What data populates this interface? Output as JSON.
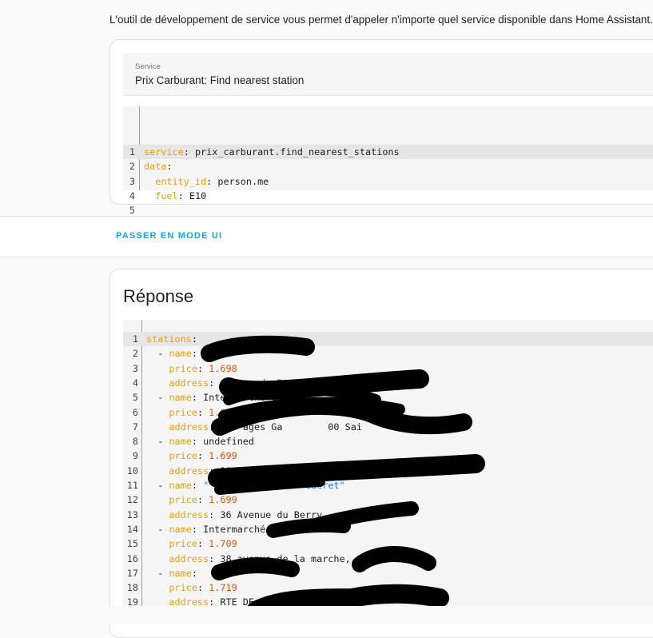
{
  "intro_text": "L'outil de développement de service vous permet d'appeler n'importe quel service disponible dans Home Assistant.",
  "service_picker": {
    "label": "Service",
    "value": "Prix Carburant: Find nearest station"
  },
  "service_yaml": {
    "lines": [
      {
        "num": "1",
        "key": "service",
        "value": "prix_carburant.find_nearest_stations",
        "value_type": "plain",
        "indent": "",
        "dash": ""
      },
      {
        "num": "2",
        "key": "data",
        "value": "",
        "value_type": "plain",
        "indent": "",
        "dash": ""
      },
      {
        "num": "3",
        "key": "entity_id",
        "value": "person.me",
        "value_type": "plain",
        "indent": "  ",
        "dash": ""
      },
      {
        "num": "4",
        "key": "fuel",
        "value": "E10",
        "value_type": "plain",
        "indent": "  ",
        "dash": ""
      },
      {
        "num": "5",
        "key": "",
        "value": "",
        "value_type": "plain",
        "indent": "",
        "dash": ""
      }
    ]
  },
  "mode_button": {
    "label": "PASSER EN MODE UI"
  },
  "response": {
    "title": "Réponse",
    "lines": [
      {
        "num": "1",
        "indent": "",
        "dash": "",
        "key": "stations",
        "value": "",
        "value_type": "plain"
      },
      {
        "num": "2",
        "indent": "  ",
        "dash": "- ",
        "key": "name",
        "value": "",
        "value_type": "plain"
      },
      {
        "num": "3",
        "indent": "    ",
        "dash": "",
        "key": "price",
        "value": "1.698",
        "value_type": "number"
      },
      {
        "num": "4",
        "indent": "    ",
        "dash": "",
        "key": "address",
        "value": "Avenue du Berry ne, 23000",
        "value_type": "string"
      },
      {
        "num": "5",
        "indent": "  ",
        "dash": "- ",
        "key": "name",
        "value": "Intermarché Guéret",
        "value_type": "plain"
      },
      {
        "num": "6",
        "indent": "    ",
        "dash": "",
        "key": "price",
        "value": "1.699",
        "value_type": "number"
      },
      {
        "num": "7",
        "indent": "    ",
        "dash": "",
        "key": "address",
        "value": "    ages Ga        00 Sai",
        "value_type": "plain"
      },
      {
        "num": "8",
        "indent": "  ",
        "dash": "- ",
        "key": "name",
        "value": "undefined",
        "value_type": "plain"
      },
      {
        "num": "9",
        "indent": "    ",
        "dash": "",
        "key": "price",
        "value": "1.699",
        "value_type": "number"
      },
      {
        "num": "10",
        "indent": "    ",
        "dash": "",
        "key": "address",
        "value": "10",
        "value_type": "plain"
      },
      {
        "num": "11",
        "indent": "  ",
        "dash": "- ",
        "key": "name",
        "value": "\"***  Leclerc *** Guéret\"",
        "value_type": "string"
      },
      {
        "num": "12",
        "indent": "    ",
        "dash": "",
        "key": "price",
        "value": "1.699",
        "value_type": "number"
      },
      {
        "num": "13",
        "indent": "    ",
        "dash": "",
        "key": "address",
        "value": "36 Avenue du Berry",
        "value_type": "plain"
      },
      {
        "num": "14",
        "indent": "  ",
        "dash": "- ",
        "key": "name",
        "value": "Intermarché",
        "value_type": "plain"
      },
      {
        "num": "15",
        "indent": "    ",
        "dash": "",
        "key": "price",
        "value": "1.709",
        "value_type": "number"
      },
      {
        "num": "16",
        "indent": "    ",
        "dash": "",
        "key": "address",
        "value": "38 avenue de la marche,",
        "value_type": "plain"
      },
      {
        "num": "17",
        "indent": "  ",
        "dash": "- ",
        "key": "name",
        "value": "",
        "value_type": "plain"
      },
      {
        "num": "18",
        "indent": "    ",
        "dash": "",
        "key": "price",
        "value": "1.719",
        "value_type": "number"
      },
      {
        "num": "19",
        "indent": "    ",
        "dash": "",
        "key": "address",
        "value": "RTE DE",
        "value_type": "plain"
      }
    ]
  },
  "colors": {
    "yaml_key": "#e8a200",
    "yaml_string": "#0288d1",
    "yaml_number": "#e65100",
    "accent": "#03a9f4",
    "redaction": "#000000"
  }
}
